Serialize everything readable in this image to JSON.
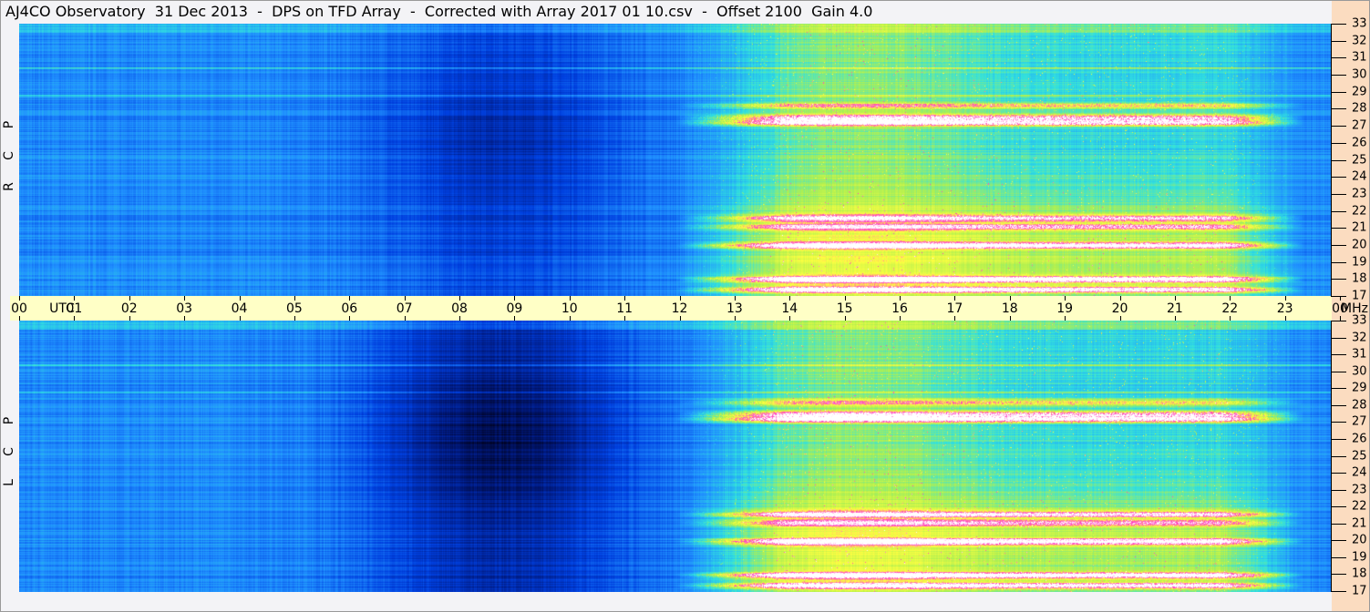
{
  "title": "AJ4CO Observatory  31 Dec 2013  -  DPS on TFD Array  -  Corrected with Array 2017 01 10.csv  -  Offset 2100  Gain 4.0",
  "chart_data": {
    "type": "heatmap",
    "title": "AJ4CO Observatory  31 Dec 2013  -  DPS on TFD Array  -  Corrected with Array 2017 01 10.csv  -  Offset 2100  Gain 4.0",
    "xlabel": "UTC",
    "ylabel": "MHz",
    "x_ticks": [
      "00",
      "01",
      "02",
      "03",
      "04",
      "05",
      "06",
      "07",
      "08",
      "09",
      "10",
      "11",
      "12",
      "13",
      "14",
      "15",
      "16",
      "17",
      "18",
      "19",
      "20",
      "21",
      "22",
      "23",
      "00"
    ],
    "y_ticks": [
      "33",
      "32",
      "31",
      "30",
      "29",
      "28",
      "27",
      "26",
      "25",
      "24",
      "23",
      "22",
      "21",
      "20",
      "19",
      "18",
      "17"
    ],
    "xlim": [
      0,
      24
    ],
    "ylim": [
      17,
      33
    ],
    "panels": [
      {
        "name": "R C P",
        "letters": [
          "R",
          "C",
          "P"
        ]
      },
      {
        "name": "L C P",
        "letters": [
          "L",
          "C",
          "P"
        ]
      }
    ],
    "colormap": [
      "#000018",
      "#001a80",
      "#0040e0",
      "#2090ff",
      "#30e0e0",
      "#b0f050",
      "#ffff40",
      "#ff40c0",
      "#ffffff"
    ]
  }
}
